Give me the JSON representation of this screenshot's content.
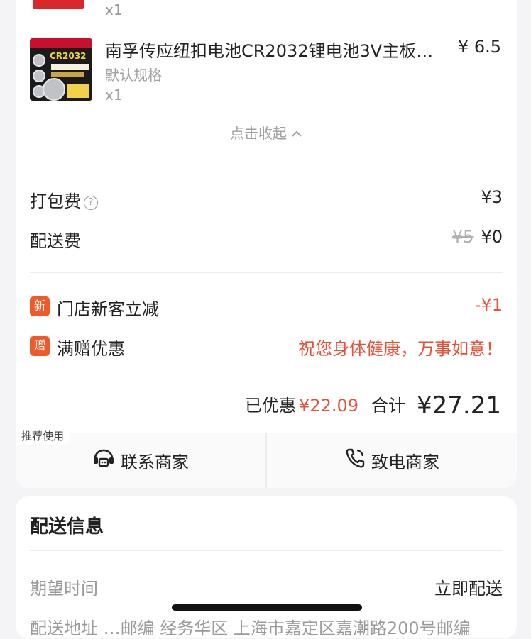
{
  "previous_item": {
    "qty": "x1"
  },
  "item": {
    "title": "南孚传应纽扣电池CR2032锂电池3V主板…",
    "price": "¥ 6.5",
    "spec": "默认规格",
    "qty": "x1",
    "image": {
      "brand": "南孚",
      "model": "CR2032",
      "description": "3V纽扣电池 保质期十年"
    }
  },
  "collapse": {
    "label": "点击收起"
  },
  "fees": {
    "packaging": {
      "label": "打包费",
      "help": "?",
      "value": "¥3"
    },
    "delivery": {
      "label": "配送费",
      "original": "¥5",
      "value": "¥0"
    }
  },
  "promos": [
    {
      "badge": "新",
      "label": "门店新客立减",
      "value": "-¥1"
    },
    {
      "badge": "赠",
      "label": "满赠优惠",
      "value": "祝您身体健康，万事如意！"
    }
  ],
  "summary": {
    "saved_label": "已优惠",
    "saved_amount": "¥22.09",
    "total_label": "合计",
    "total_amount": "¥27.21"
  },
  "actions": {
    "recommend_tag": "推荐使用",
    "contact": "联系商家",
    "call": "致电商家"
  },
  "delivery_info": {
    "title": "配送信息",
    "expected_time_label": "期望时间",
    "expected_time_value": "立即配送",
    "address_partial": "配送地址 …邮编 经务华区 上海市嘉定区嘉潮路200号邮编"
  },
  "colors": {
    "accent": "#e5523a",
    "badge": "#ef5a2b",
    "muted": "#9a9a9a",
    "background": "#f4f4f6"
  }
}
